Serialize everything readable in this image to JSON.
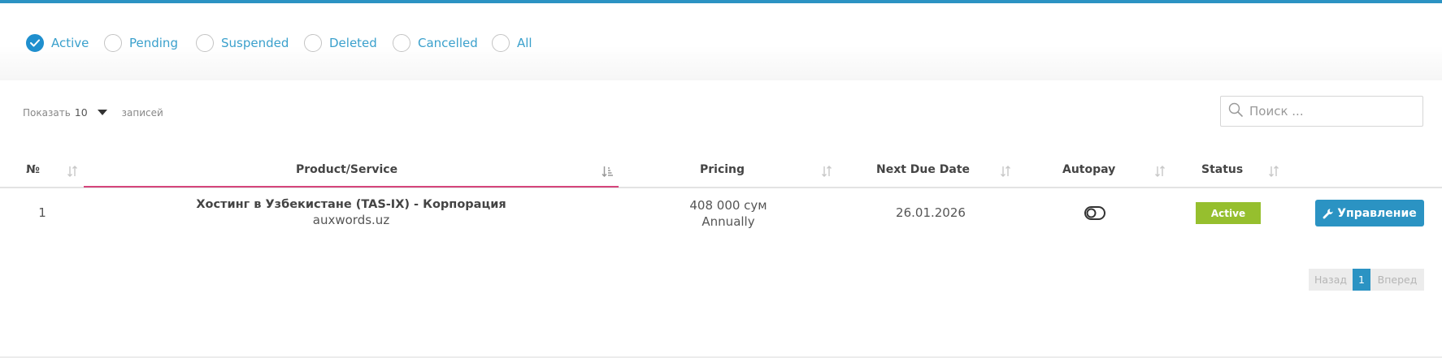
{
  "filters": [
    {
      "label": "Active",
      "checked": true
    },
    {
      "label": "Pending",
      "checked": false
    },
    {
      "label": "Suspended",
      "checked": false
    },
    {
      "label": "Deleted",
      "checked": false
    },
    {
      "label": "Cancelled",
      "checked": false
    },
    {
      "label": "All",
      "checked": false
    }
  ],
  "length_menu": {
    "prefix": "Показать",
    "value": "10",
    "suffix": "записей"
  },
  "search": {
    "placeholder": "Поиск ..."
  },
  "table": {
    "columns": [
      "№",
      "Product/Service",
      "Pricing",
      "Next Due Date",
      "Autopay",
      "Status"
    ],
    "rows": [
      {
        "num": "1",
        "product": "Хостинг в Узбекистане (TAS-IX) - Корпорация",
        "domain": "auxwords.uz",
        "price": "408 000 сум",
        "cycle": "Annually",
        "due_date": "26.01.2026",
        "status": "Active",
        "action_label": "Управление"
      }
    ]
  },
  "pagination": {
    "prev": "Назад",
    "page": "1",
    "next": "Вперед"
  },
  "colors": {
    "accent": "#2b93c3",
    "status_active": "#96bf2e",
    "sorted_column": "#d5457c"
  }
}
